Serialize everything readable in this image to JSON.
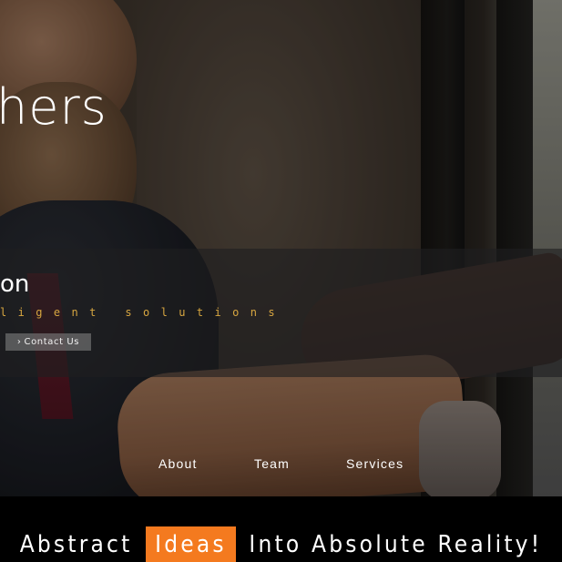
{
  "brand": {
    "logo_fragment": "hers"
  },
  "hero": {
    "title_fragment": "on",
    "tagline_fragment": "ligent solutions",
    "contact_button": {
      "label": "Contact Us",
      "icon": "chevron-right-icon"
    }
  },
  "nav": {
    "items": [
      {
        "label": "About"
      },
      {
        "label": "Team"
      },
      {
        "label": "Services"
      }
    ]
  },
  "slogan": {
    "before": "Abstract",
    "highlight": "Ideas",
    "after": "Into Absolute Reality!",
    "highlight_color": "#f47a1f"
  },
  "colors": {
    "accent": "#f47a1f",
    "tagline": "#d7a640",
    "band": "rgba(30,30,32,0.62)"
  }
}
